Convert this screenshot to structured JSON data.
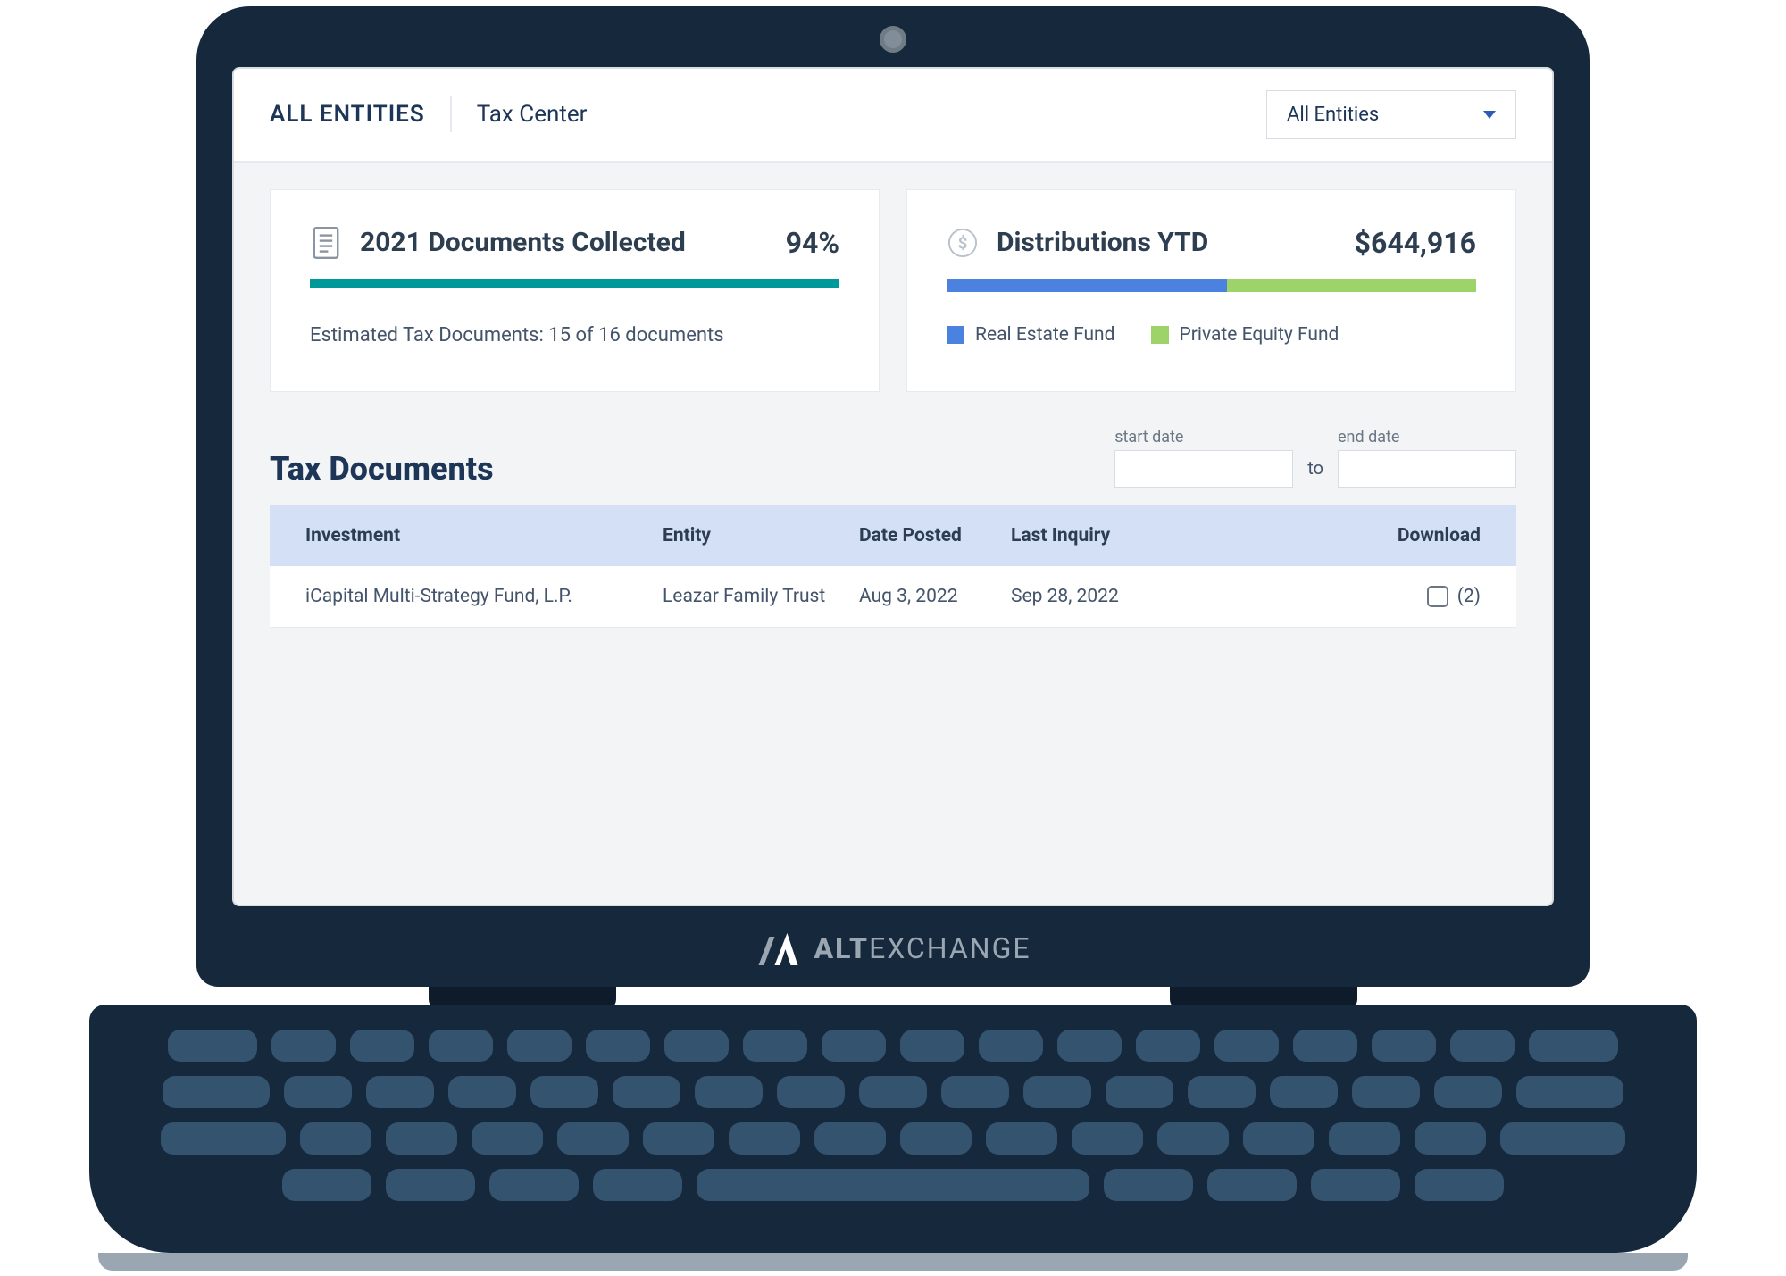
{
  "header": {
    "entities_label": "ALL ENTITIES",
    "page_title": "Tax Center",
    "select_value": "All Entities"
  },
  "cards": {
    "collected": {
      "title": "2021 Documents Collected",
      "value": "94%",
      "estimate": "Estimated Tax Documents: 15 of 16 documents"
    },
    "distributions": {
      "title": "Distributions YTD",
      "value": "$644,916",
      "legend": {
        "item1": "Real Estate Fund",
        "item2": "Private Equity Fund"
      }
    }
  },
  "documents": {
    "section_title": "Tax Documents",
    "date_range": {
      "start_label": "start date",
      "to": "to",
      "end_label": "end date"
    },
    "columns": {
      "investment": "Investment",
      "entity": "Entity",
      "date_posted": "Date Posted",
      "last_inquiry": "Last Inquiry",
      "download": "Download"
    },
    "rows": [
      {
        "investment": "iCapital Multi-Strategy Fund, L.P.",
        "entity": "Leazar Family Trust",
        "date_posted": "Aug 3, 2022",
        "last_inquiry": "Sep 28, 2022",
        "download_count": "(2)"
      }
    ]
  },
  "brand": {
    "part1": "ALT",
    "part2": "EXCHANGE"
  }
}
